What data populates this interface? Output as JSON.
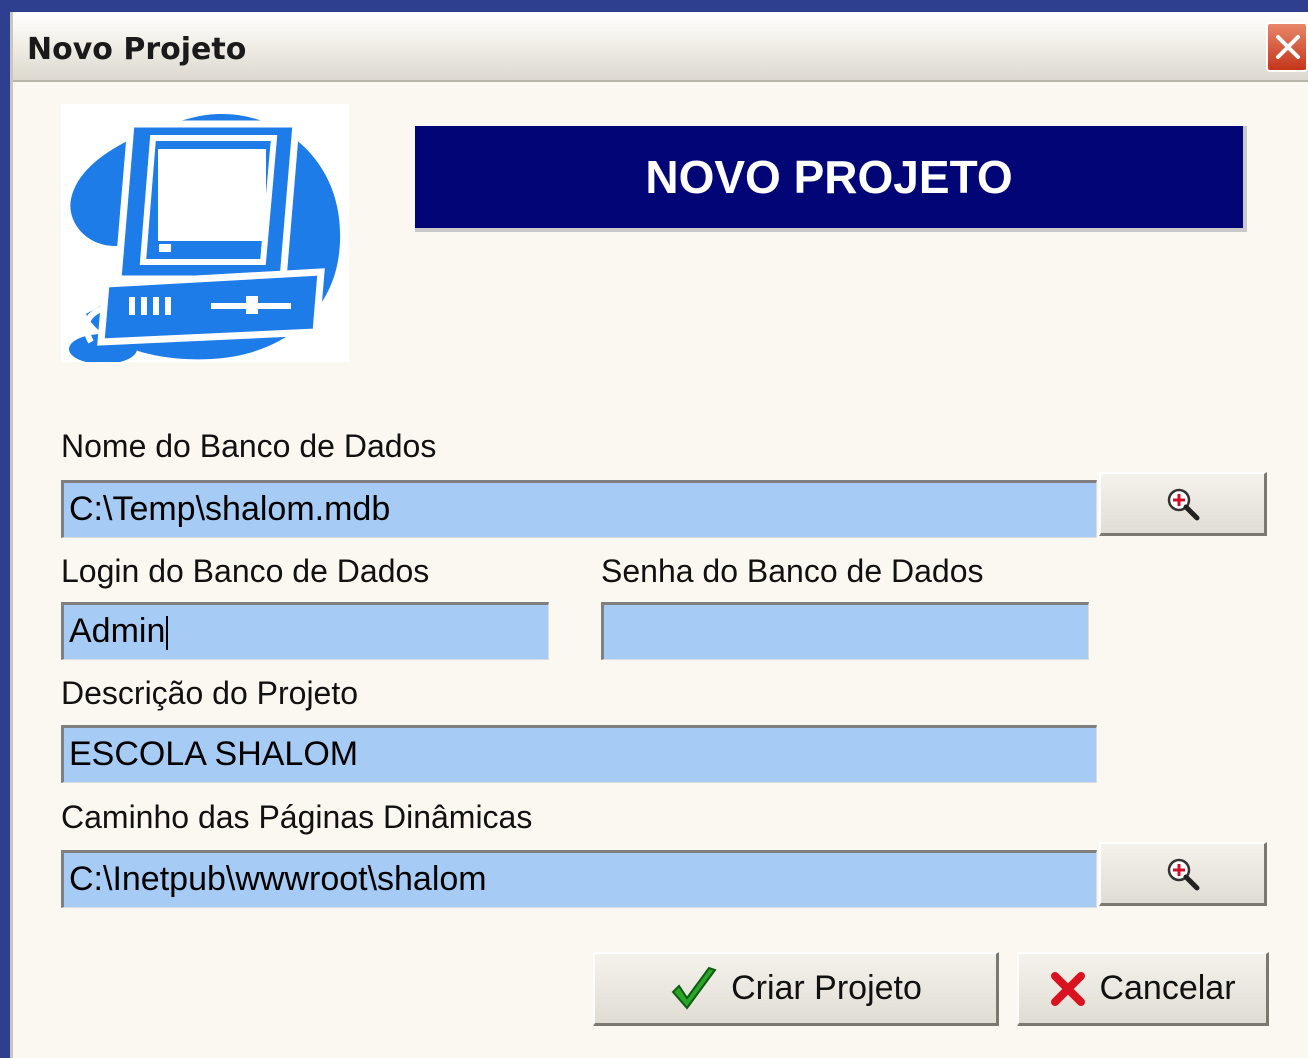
{
  "window": {
    "title": "Novo Projeto"
  },
  "banner": {
    "text": "NOVO PROJETO"
  },
  "fields": {
    "db_name": {
      "label": "Nome do Banco de Dados",
      "value": "C:\\Temp\\shalom.mdb"
    },
    "db_login": {
      "label": "Login do Banco de Dados",
      "value": "Admin"
    },
    "db_password": {
      "label": "Senha do Banco de Dados",
      "value": ""
    },
    "description": {
      "label": "Descrição do Projeto",
      "value": "ESCOLA SHALOM"
    },
    "dynamic_path": {
      "label": "Caminho das Páginas Dinâmicas",
      "value": "C:\\Inetpub\\wwwroot\\shalom"
    }
  },
  "buttons": {
    "create": "Criar Projeto",
    "cancel": "Cancelar"
  },
  "icons": {
    "logo": "computer-icon",
    "browse": "magnifier-zoom-icon",
    "create": "green-check-icon",
    "cancel": "red-x-icon",
    "close": "close-icon"
  },
  "colors": {
    "banner_bg": "#020575",
    "field_bg": "#a6cbf4",
    "dialog_bg": "#fbf8f2",
    "logo_blue": "#1e7ce8"
  }
}
